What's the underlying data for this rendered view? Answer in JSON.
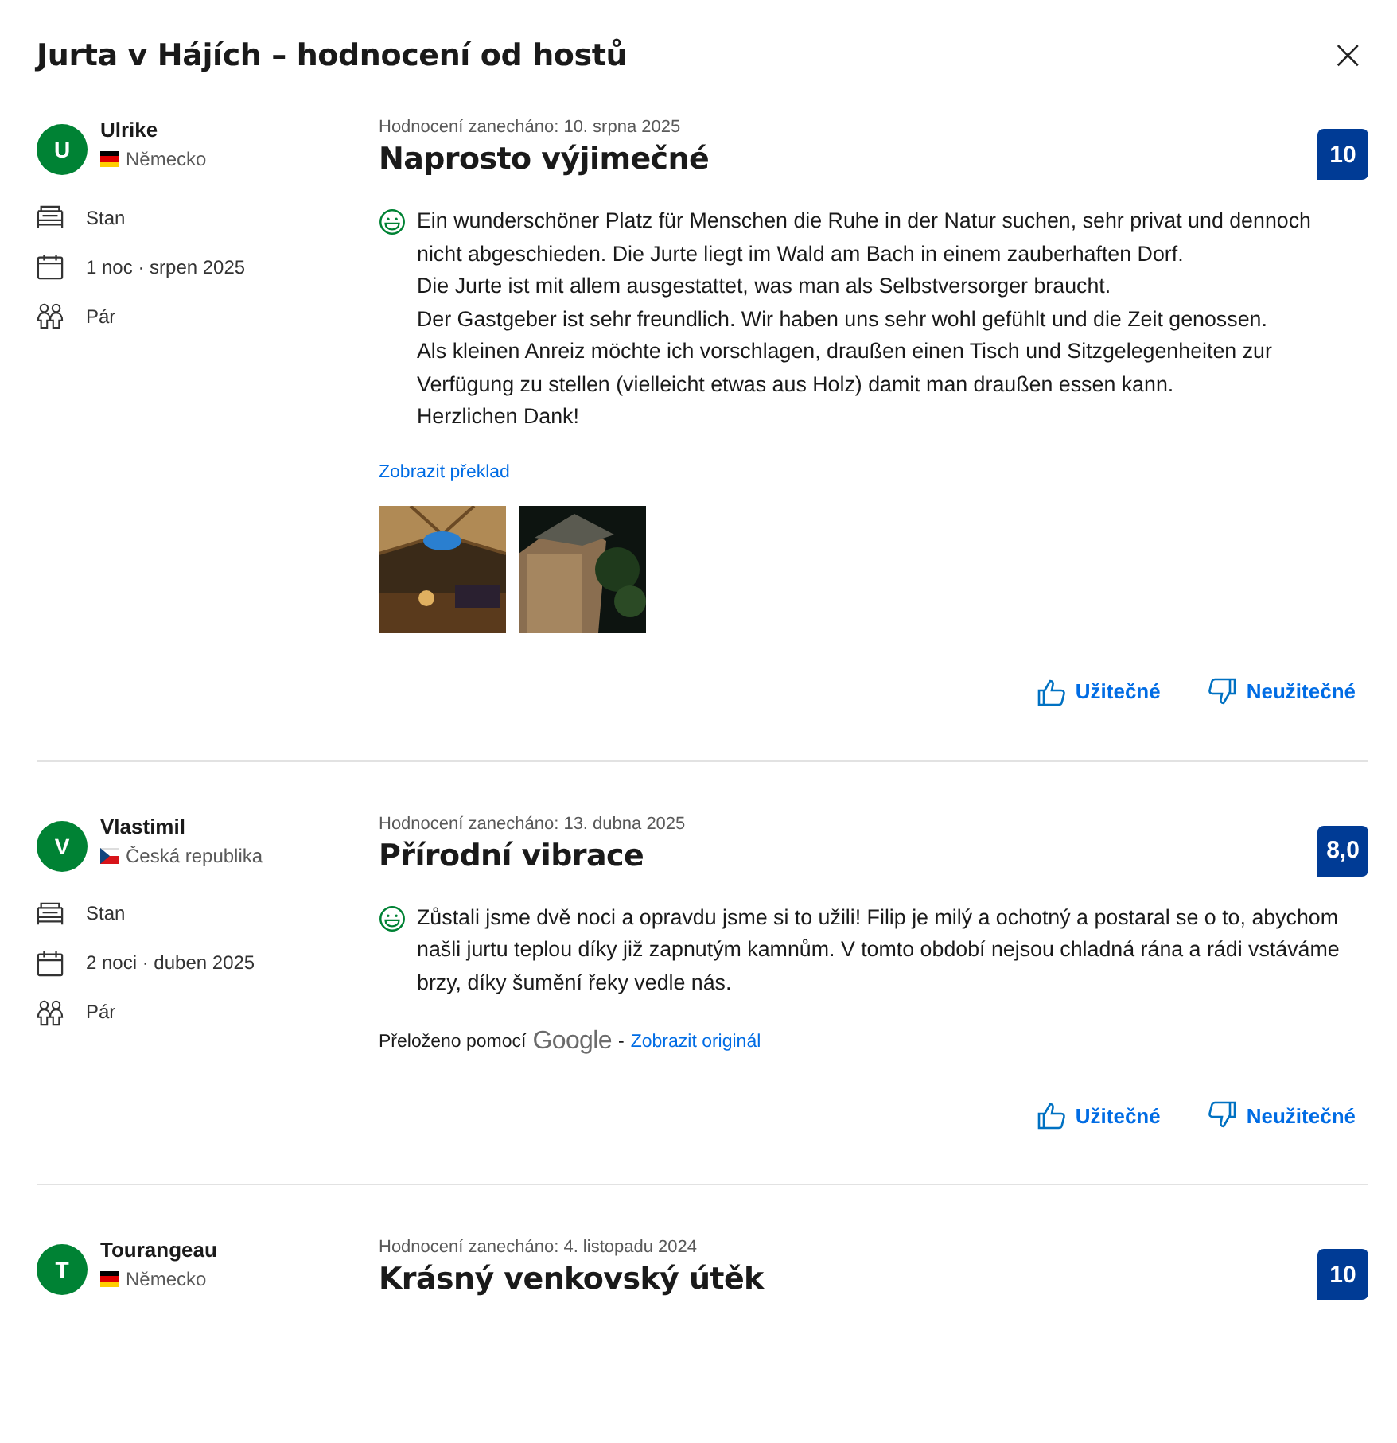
{
  "dialog": {
    "title": "Jurta v Hájích – hodnocení od hostů",
    "close": "×"
  },
  "reviews": [
    {
      "avatar": "U",
      "name": "Ulrike",
      "country": {
        "kind": "de",
        "name": "Německo"
      },
      "details": [
        {
          "kind": "bed",
          "text": "Stan"
        },
        {
          "kind": "calendar",
          "text": "1 noc · srpen 2025"
        },
        {
          "kind": "people",
          "text": "Pár"
        }
      ],
      "date": "Hodnocení zanecháno: 10. srpna 2025",
      "title": "Naprosto výjimečné",
      "score": "10",
      "text": "Ein wunderschöner Platz für Menschen die Ruhe in der Natur suchen, sehr privat und dennoch nicht abgeschieden. Die Jurte liegt im Wald am Bach in einem zauberhaften Dorf.\nDie Jurte ist mit allem ausgestattet, was man als Selbstversorger braucht.\nDer Gastgeber ist sehr freundlich. Wir haben uns sehr wohl gefühlt und die Zeit genossen.\nAls kleinen Anreiz möchte ich vorschlagen, draußen einen Tisch und Sitzgelegenheiten zur Verfügung zu stellen (vielleicht etwas aus Holz) damit man draußen essen kann.\nHerzlichen Dank!",
      "translation": {
        "link": "Zobrazit překlad"
      },
      "helpful": "Užitečné",
      "unhelpful": "Neužitečné"
    },
    {
      "avatar": "V",
      "name": "Vlastimil",
      "country": {
        "kind": "cz",
        "name": "Česká republika"
      },
      "details": [
        {
          "kind": "bed",
          "text": "Stan"
        },
        {
          "kind": "calendar",
          "text": "2 noci · duben 2025"
        },
        {
          "kind": "people",
          "text": "Pár"
        }
      ],
      "date": "Hodnocení zanecháno: 13. dubna 2025",
      "title": "Přírodní vibrace",
      "score": "8,0",
      "text": "Zůstali jsme dvě noci a opravdu jsme si to užili! Filip je milý a ochotný a postaral se o to, abychom našli jurtu teplou díky již zapnutým kamnům. V tomto období nejsou chladná rána a rádi vstáváme brzy, díky šumění řeky vedle nás.",
      "translation": {
        "label": "Přeloženo pomocí",
        "provider": "Google",
        "separator": "-",
        "link": "Zobrazit originál"
      },
      "helpful": "Užitečné",
      "unhelpful": "Neužitečné"
    },
    {
      "avatar": "T",
      "name": "Tourangeau",
      "country": {
        "kind": "de",
        "name": "Německo"
      },
      "date": "Hodnocení zanecháno: 4. listopadu 2024",
      "title": "Krásný venkovský útěk",
      "score": "10"
    }
  ]
}
